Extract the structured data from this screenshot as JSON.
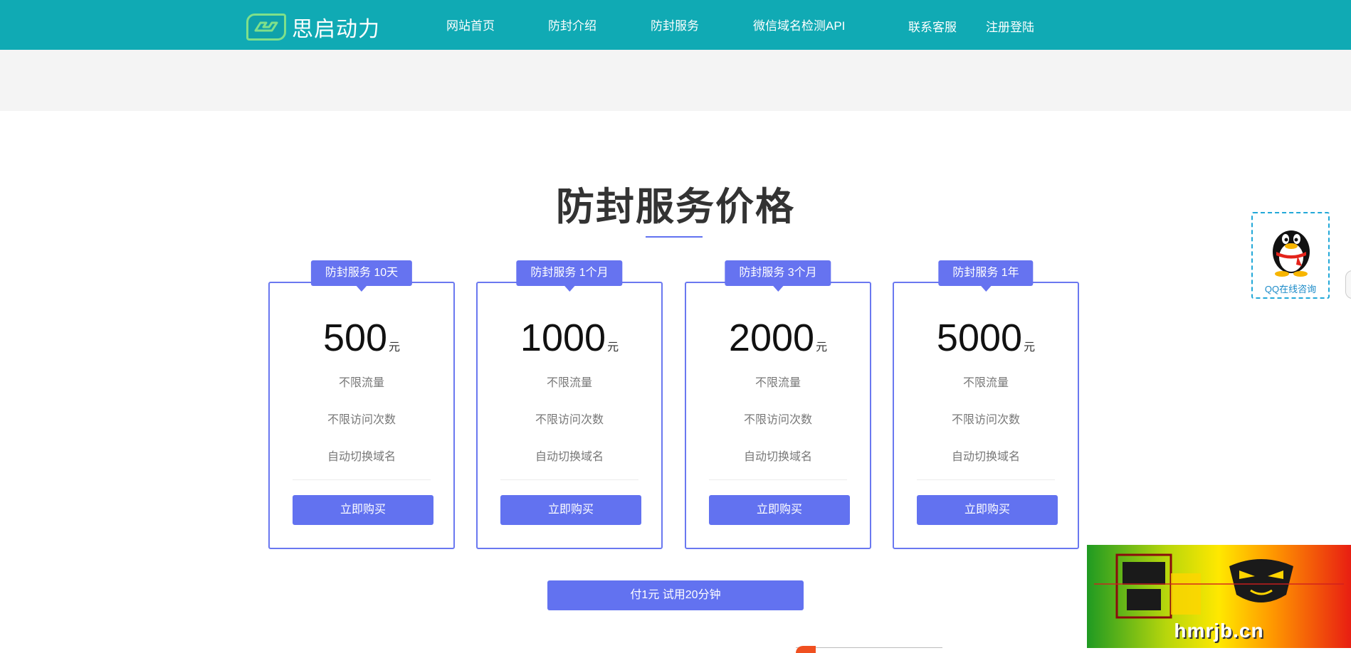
{
  "header": {
    "logo_text": "思启动力",
    "nav": [
      "网站首页",
      "防封介绍",
      "防封服务",
      "微信域名检测API",
      "联系客服",
      "注册登陆"
    ]
  },
  "section": {
    "title": "防封服务价格"
  },
  "plans": [
    {
      "tag": "防封服务 10天",
      "price": "500",
      "unit": "元",
      "features": [
        "不限流量",
        "不限访问次数",
        "自动切换域名"
      ],
      "button": "立即购买"
    },
    {
      "tag": "防封服务 1个月",
      "price": "1000",
      "unit": "元",
      "features": [
        "不限流量",
        "不限访问次数",
        "自动切换域名"
      ],
      "button": "立即购买"
    },
    {
      "tag": "防封服务 3个月",
      "price": "2000",
      "unit": "元",
      "features": [
        "不限流量",
        "不限访问次数",
        "自动切换域名"
      ],
      "button": "立即购买"
    },
    {
      "tag": "防封服务 1年",
      "price": "5000",
      "unit": "元",
      "features": [
        "不限流量",
        "不限访问次数",
        "自动切换域名"
      ],
      "button": "立即购买"
    }
  ],
  "trial_button": "付1元 试用20分钟",
  "qq_widget": {
    "label": "QQ在线咨询"
  },
  "watermark": {
    "text": "hmrjb.cn"
  },
  "colors": {
    "header": "#10aab4",
    "accent": "#6272f0",
    "card_border": "#6a78f0"
  }
}
